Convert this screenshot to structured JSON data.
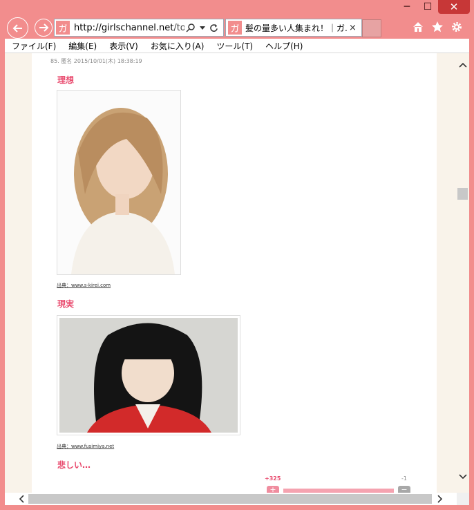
{
  "browser": {
    "url_host": "http://girlschannel.net",
    "url_path": "/topic",
    "favicon_char": "ガ",
    "tab_title": "髪の量多い人集まれ！｜ガ...",
    "tab_close": "×",
    "caption": {
      "minimize": "─",
      "maximize": "☐",
      "close": "✕"
    }
  },
  "menu": [
    "ファイル(F)",
    "編集(E)",
    "表示(V)",
    "お気に入り(A)",
    "ツール(T)",
    "ヘルプ(H)"
  ],
  "comment": {
    "meta": "85. 匿名 2015/10/01(木) 18:38:19",
    "label_ideal": "理想",
    "source1": "出典：www.s-kirei.com",
    "label_reality": "現実",
    "source2": "出典：www.fusimiya.net",
    "sad": "悲しい…",
    "votes_plus": "+325",
    "votes_minus": "-1",
    "plus_btn": "+",
    "minus_btn": "−"
  },
  "colors": {
    "accent": "#e94c6f",
    "chrome": "#f28d8d"
  }
}
